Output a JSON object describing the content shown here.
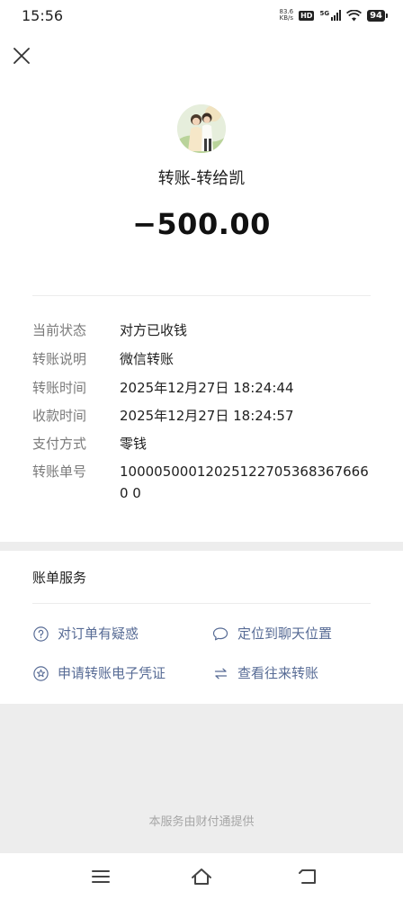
{
  "status_bar": {
    "time": "15:56",
    "speed_value": "83.6",
    "speed_unit": "KB/s",
    "hd": "HD",
    "network": "5G",
    "battery": "94"
  },
  "header": {
    "close_icon": "close-icon"
  },
  "transfer": {
    "title": "转账-转给凯",
    "amount": "−500.00"
  },
  "details": [
    {
      "label": "当前状态",
      "value": "对方已收钱"
    },
    {
      "label": "转账说明",
      "value": "微信转账"
    },
    {
      "label": "转账时间",
      "value": "2025年12月27日 18:24:44"
    },
    {
      "label": "收款时间",
      "value": "2025年12月27日 18:24:57"
    },
    {
      "label": "支付方式",
      "value": "零钱"
    },
    {
      "label": "转账单号",
      "value": "100005000120251227053683676660 0"
    }
  ],
  "services": {
    "title": "账单服务",
    "items": [
      {
        "label": "对订单有疑惑",
        "icon": "question-icon"
      },
      {
        "label": "定位到聊天位置",
        "icon": "chat-bubble-icon"
      },
      {
        "label": "申请转账电子凭证",
        "icon": "certificate-icon"
      },
      {
        "label": "查看往来转账",
        "icon": "exchange-icon"
      }
    ]
  },
  "footer": {
    "provider": "本服务由财付通提供"
  },
  "colors": {
    "link": "#576b95",
    "label_gray": "#7a7a7a",
    "background_gray": "#ededed"
  }
}
